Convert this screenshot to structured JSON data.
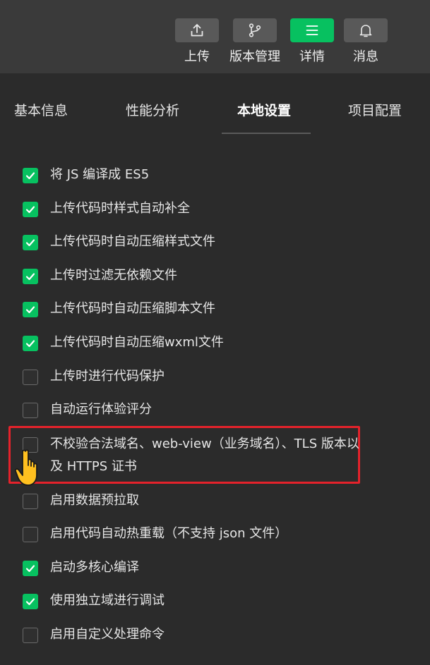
{
  "toolbar": {
    "buttons": [
      {
        "label": "上传",
        "icon": "upload-icon",
        "active": false
      },
      {
        "label": "版本管理",
        "icon": "branch-icon",
        "active": false
      },
      {
        "label": "详情",
        "icon": "menu-icon",
        "active": true
      },
      {
        "label": "消息",
        "icon": "bell-icon",
        "active": false
      }
    ]
  },
  "tabs": {
    "items": [
      {
        "label": "基本信息",
        "active": false
      },
      {
        "label": "性能分析",
        "active": false
      },
      {
        "label": "本地设置",
        "active": true
      },
      {
        "label": "项目配置",
        "active": false
      }
    ]
  },
  "options": [
    {
      "label": "将 JS 编译成 ES5",
      "checked": true
    },
    {
      "label": "上传代码时样式自动补全",
      "checked": true
    },
    {
      "label": "上传代码时自动压缩样式文件",
      "checked": true
    },
    {
      "label": "上传时过滤无依赖文件",
      "checked": true
    },
    {
      "label": "上传代码时自动压缩脚本文件",
      "checked": true
    },
    {
      "label": "上传代码时自动压缩wxml文件",
      "checked": true
    },
    {
      "label": "上传时进行代码保护",
      "checked": false
    },
    {
      "label": "自动运行体验评分",
      "checked": false
    },
    {
      "label": "不校验合法域名、web-view（业务域名）、TLS 版本以及 HTTPS 证书",
      "checked": false,
      "highlighted": true
    },
    {
      "label": "启用数据预拉取",
      "checked": false
    },
    {
      "label": "启用代码自动热重载（不支持 json 文件）",
      "checked": false
    },
    {
      "label": "启动多核心编译",
      "checked": true
    },
    {
      "label": "使用独立域进行调试",
      "checked": true
    },
    {
      "label": "启用自定义处理命令",
      "checked": false
    }
  ],
  "colors": {
    "accent": "#07c160",
    "highlight": "#e5222b",
    "background": "#2b2b2b",
    "toolbar_bg": "#3a3a3a"
  }
}
